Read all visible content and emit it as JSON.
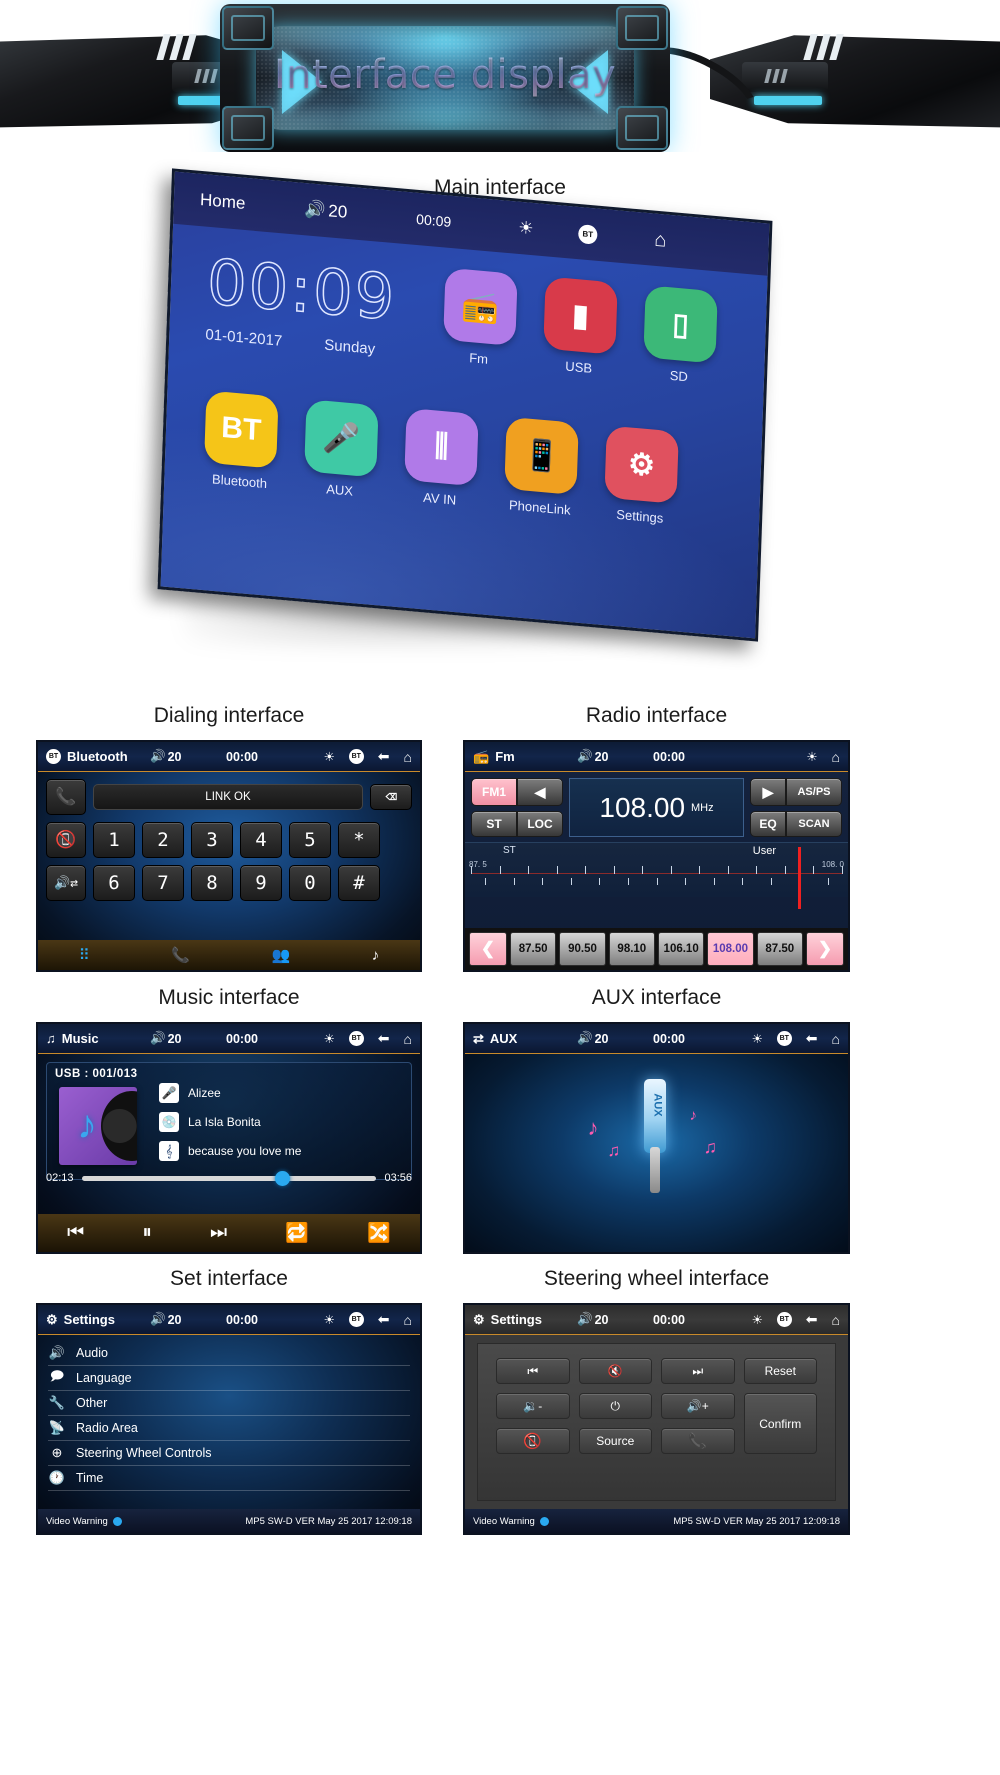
{
  "banner": {
    "title": "Interface display"
  },
  "sections": {
    "main": "Main interface",
    "dialing": "Dialing interface",
    "radio": "Radio interface",
    "music": "Music interface",
    "aux": "AUX interface",
    "settings": "Set interface",
    "steering": "Steering wheel interface"
  },
  "main_interface": {
    "status": {
      "title": "Home",
      "volume": "20",
      "time": "00:09",
      "brightness_icon": "sun-icon",
      "bt_icon": "bt-icon",
      "home_icon": "home-icon"
    },
    "clock": {
      "hours": "00",
      "sep": ":",
      "minutes": "09",
      "date": "01-01-2017",
      "weekday": "Sunday"
    },
    "row1": [
      {
        "label": "Fm",
        "color": "#b07ae8",
        "glyph": "radio-icon"
      },
      {
        "label": "USB",
        "color": "#d83a4a",
        "glyph": "usb-icon"
      },
      {
        "label": "SD",
        "color": "#3cb878",
        "glyph": "sd-card-icon"
      }
    ],
    "row2": [
      {
        "label": "Bluetooth",
        "color": "#f5c518",
        "glyph": "BT"
      },
      {
        "label": "AUX",
        "color": "#3fc9a5",
        "glyph": "aux-plug-icon"
      },
      {
        "label": "AV IN",
        "color": "#b07ae8",
        "glyph": "rca-jacks-icon"
      },
      {
        "label": "PhoneLink",
        "color": "#f0a020",
        "glyph": "phonelink-icon"
      },
      {
        "label": "Settings",
        "color": "#e0515f",
        "glyph": "gear-icon"
      }
    ]
  },
  "dialing": {
    "status": {
      "title": "Bluetooth",
      "volume": "20",
      "time": "00:00"
    },
    "link_status": "LINK OK",
    "call_icon": "phone-call-icon",
    "hangup_icon": "phone-hangup-icon",
    "mute_icon": "speaker-swap-icon",
    "delete_icon": "backspace-icon",
    "keys_row1": [
      "1",
      "2",
      "3",
      "4",
      "5",
      "*"
    ],
    "keys_row2": [
      "6",
      "7",
      "8",
      "9",
      "0",
      "#"
    ],
    "nav": [
      "keypad-icon",
      "call-log-icon",
      "contacts-icon",
      "bt-music-icon"
    ]
  },
  "radio": {
    "status": {
      "title": "Fm",
      "volume": "20",
      "time": "00:00"
    },
    "band": "FM1",
    "prev_icon": "triangle-left-icon",
    "st_label": "ST",
    "loc_label": "LOC",
    "frequency": "108.00",
    "unit": "MHz",
    "play_icon": "triangle-right-icon",
    "asps_label": "AS/PS",
    "eq_label": "EQ",
    "scan_label": "SCAN",
    "scale": {
      "left_label": "87. 5",
      "right_label": "108. 0",
      "st_tag": "ST",
      "user_tag": "User",
      "marker_pct": 87
    },
    "presets": [
      "87.50",
      "90.50",
      "98.10",
      "106.10",
      "108.00",
      "87.50"
    ],
    "active_preset_index": 4,
    "nav_prev": "chevron-left-icon",
    "nav_next": "chevron-right-icon"
  },
  "music": {
    "status": {
      "title": "Music",
      "volume": "20",
      "time": "00:00"
    },
    "source": "USB : 001/013",
    "artist": "Alizee",
    "album": "La Isla Bonita",
    "song": "because you love me",
    "elapsed": "02:13",
    "duration": "03:56",
    "progress_pct": 68,
    "controls": [
      "prev-track-icon",
      "pause-icon",
      "next-track-icon",
      "repeat-icon",
      "shuffle-icon"
    ]
  },
  "aux": {
    "status": {
      "title": "AUX",
      "volume": "20",
      "time": "00:00"
    },
    "plug_label": "AUX"
  },
  "settings": {
    "status": {
      "title": "Settings",
      "volume": "20",
      "time": "00:00"
    },
    "items": [
      {
        "label": "Audio",
        "icon": "speaker-icon"
      },
      {
        "label": "Language",
        "icon": "chat-icon"
      },
      {
        "label": "Other",
        "icon": "wrench-icon"
      },
      {
        "label": "Radio Area",
        "icon": "antenna-icon"
      },
      {
        "label": "Steering Wheel Controls",
        "icon": "steering-wheel-icon"
      },
      {
        "label": "Time",
        "icon": "clock-icon"
      }
    ],
    "footer": {
      "warning": "Video Warning",
      "version": "MP5 SW-D VER May 25 2017 12:09:18"
    }
  },
  "steering": {
    "status": {
      "title": "Settings",
      "volume": "20",
      "time": "00:00"
    },
    "buttons": [
      {
        "label": "prev-track-icon",
        "type": "icon"
      },
      {
        "label": "mute-icon",
        "type": "icon"
      },
      {
        "label": "next-track-icon",
        "type": "icon"
      },
      {
        "label": "Reset",
        "type": "text"
      },
      {
        "label": "vol-down-icon",
        "type": "icon"
      },
      {
        "label": "power-icon",
        "type": "icon"
      },
      {
        "label": "vol-up-icon",
        "type": "icon"
      },
      {
        "label": "Confirm",
        "type": "text"
      },
      {
        "label": "hangup-icon",
        "type": "icon"
      },
      {
        "label": "Source",
        "type": "text"
      },
      {
        "label": "answer-icon",
        "type": "icon"
      }
    ],
    "footer": {
      "warning": "Video Warning",
      "version": "MP5 SW-D VER May 25 2017 12:09:18"
    }
  },
  "colors": {
    "accent_blue": "#2aa9f0",
    "pink": "#ffaebd",
    "amber": "#c98a2a"
  }
}
